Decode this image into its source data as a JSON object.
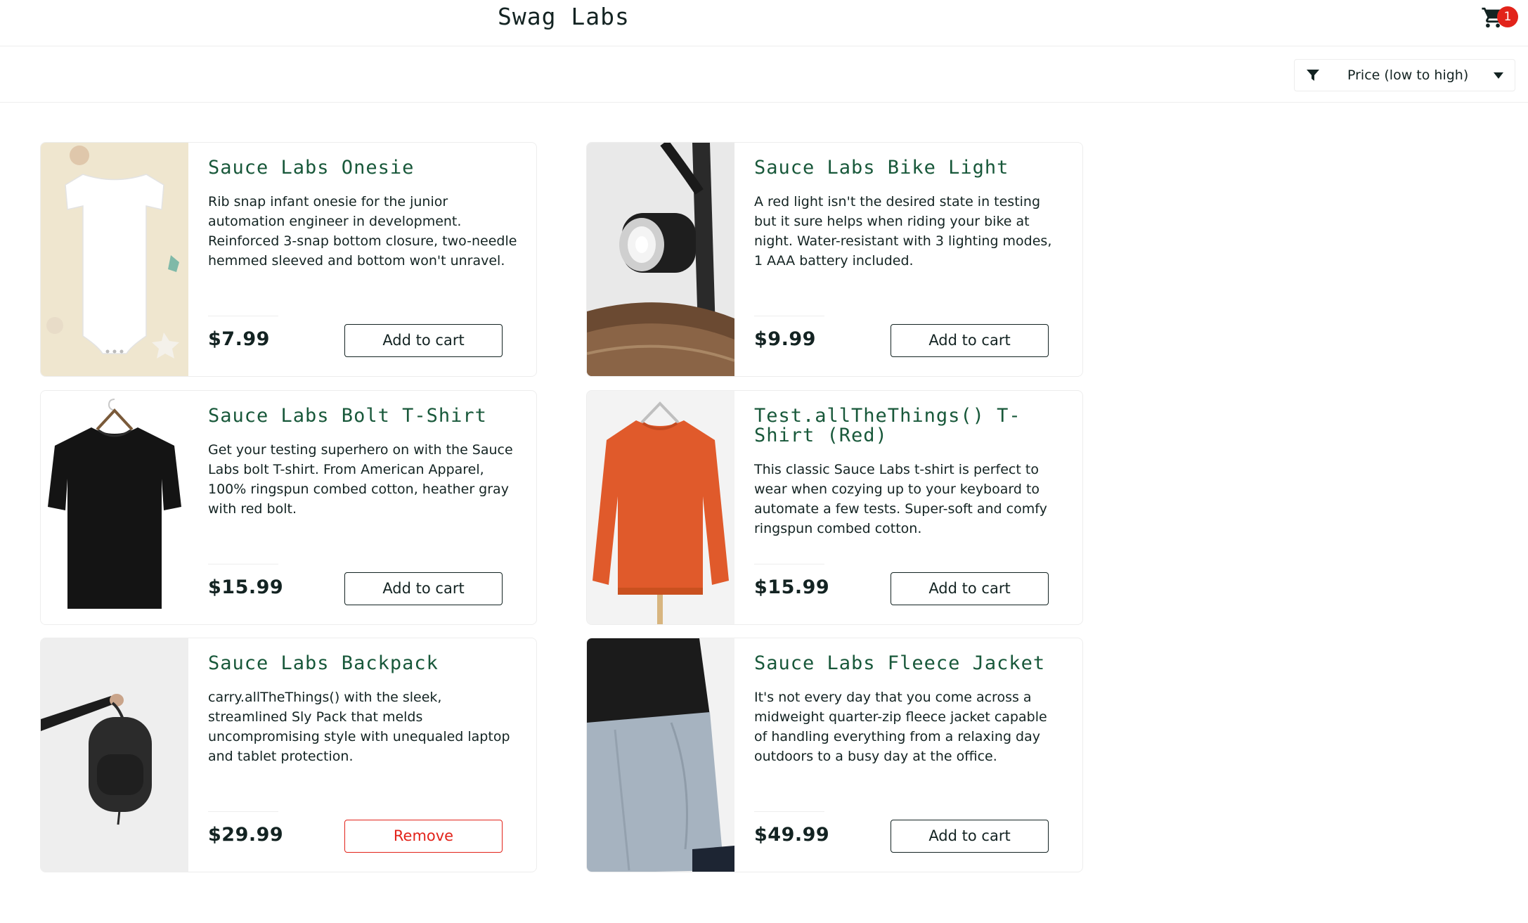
{
  "header": {
    "logo": "Swag Labs",
    "cart_icon": "shopping-cart-icon",
    "cart_count": "1",
    "badge_color": "#e2231a"
  },
  "sort": {
    "filter_icon": "filter-icon",
    "selected": "Price (low to high)",
    "caret_icon": "caret-down-icon"
  },
  "colors": {
    "title": "#18583a",
    "text": "#132322",
    "remove": "#e2231a"
  },
  "products": [
    {
      "name": "Sauce Labs Onesie",
      "description": "Rib snap infant onesie for the junior automation engineer in development. Reinforced 3-snap bottom closure, two-needle hemmed sleeved and bottom won't unravel.",
      "price": "$7.99",
      "button": "Add to cart"
    },
    {
      "name": "Sauce Labs Bike Light",
      "description": "A red light isn't the desired state in testing but it sure helps when riding your bike at night. Water-resistant with 3 lighting modes, 1 AAA battery included.",
      "price": "$9.99",
      "button": "Add to cart"
    },
    {
      "name": "Sauce Labs Bolt T-Shirt",
      "description": "Get your testing superhero on with the Sauce Labs bolt T-shirt. From American Apparel, 100% ringspun combed cotton, heather gray with red bolt.",
      "price": "$15.99",
      "button": "Add to cart"
    },
    {
      "name": "Test.allTheThings() T-Shirt (Red)",
      "description": "This classic Sauce Labs t-shirt is perfect to wear when cozying up to your keyboard to automate a few tests. Super-soft and comfy ringspun combed cotton.",
      "price": "$15.99",
      "button": "Add to cart"
    },
    {
      "name": "Sauce Labs Backpack",
      "description": "carry.allTheThings() with the sleek, streamlined Sly Pack that melds uncompromising style with unequaled laptop and tablet protection.",
      "price": "$29.99",
      "button": "Remove"
    },
    {
      "name": "Sauce Labs Fleece Jacket",
      "description": "It's not every day that you come across a midweight quarter-zip fleece jacket capable of handling everything from a relaxing day outdoors to a busy day at the office.",
      "price": "$49.99",
      "button": "Add to cart"
    }
  ]
}
